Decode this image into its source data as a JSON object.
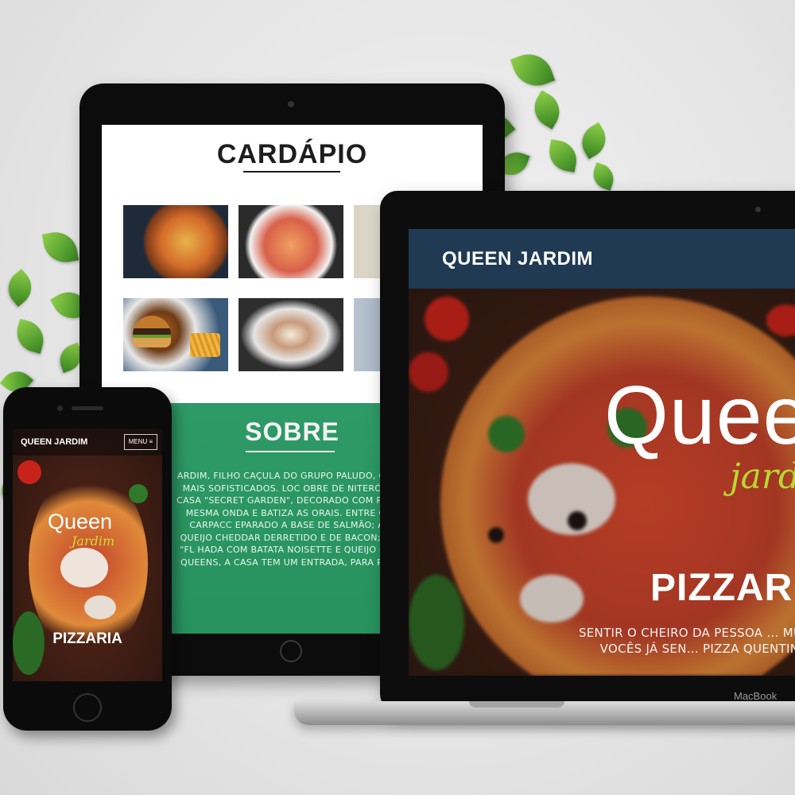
{
  "tablet": {
    "menu_title": "CARDÁPIO",
    "menu_items": [
      "pizza",
      "rolls",
      "dish",
      "burger-and-fries",
      "cheesecake",
      "dish"
    ],
    "about_title": "SOBRE",
    "about_text": "ARDIM, FILHO CAÇULA DO GRUPO PALUDO, CO ÇO COM PRATOS MAIS SOFISTICADOS. LOC OBRE DE NITERÓI JARDIM ICARAÍ, A CASA \"SECRET GARDEN\", DECORADO COM PLAN \"EMBARCA\" NA MESMA ONDA E BATIZA AS ORAIS. ENTRE OS DESTAQUES: O CARPACC EPARADO A BASE DE SALMÃO; A BATATA FR COM QUEIJO CHEDDAR DERRETIDO E DE BACON; OU A CARNE-SECA \"FL HADA COM BATATA NOISETTE E QUEIJO CO MO EM OUTROS QUEENS, A CASA TEM UM ENTRADA, PARA REAFIRMAR MARCA."
  },
  "laptop": {
    "nav_brand": "QUEEN JARDIM",
    "hero_title": "Queen",
    "hero_subtitle": "jardim",
    "hero_heading": "PIZZARIA",
    "hero_tagline": "SENTIR O CHEIRO DA PESSOA ... MUITO BOM, MAS VOCÊS JÁ SEN... PIZZA QUENTINHA SAINDO",
    "brand_label": "MacBook"
  },
  "phone": {
    "nav_brand": "QUEEN JARDIM",
    "menu_button": "MENU ≡",
    "hero_title": "Queen",
    "hero_subtitle": "Jardim",
    "hero_heading": "PIZZARIA"
  },
  "colors": {
    "laptop_nav": "#1f3a52",
    "about_bg": "#2e9a66",
    "accent_green": "#b9d832"
  }
}
